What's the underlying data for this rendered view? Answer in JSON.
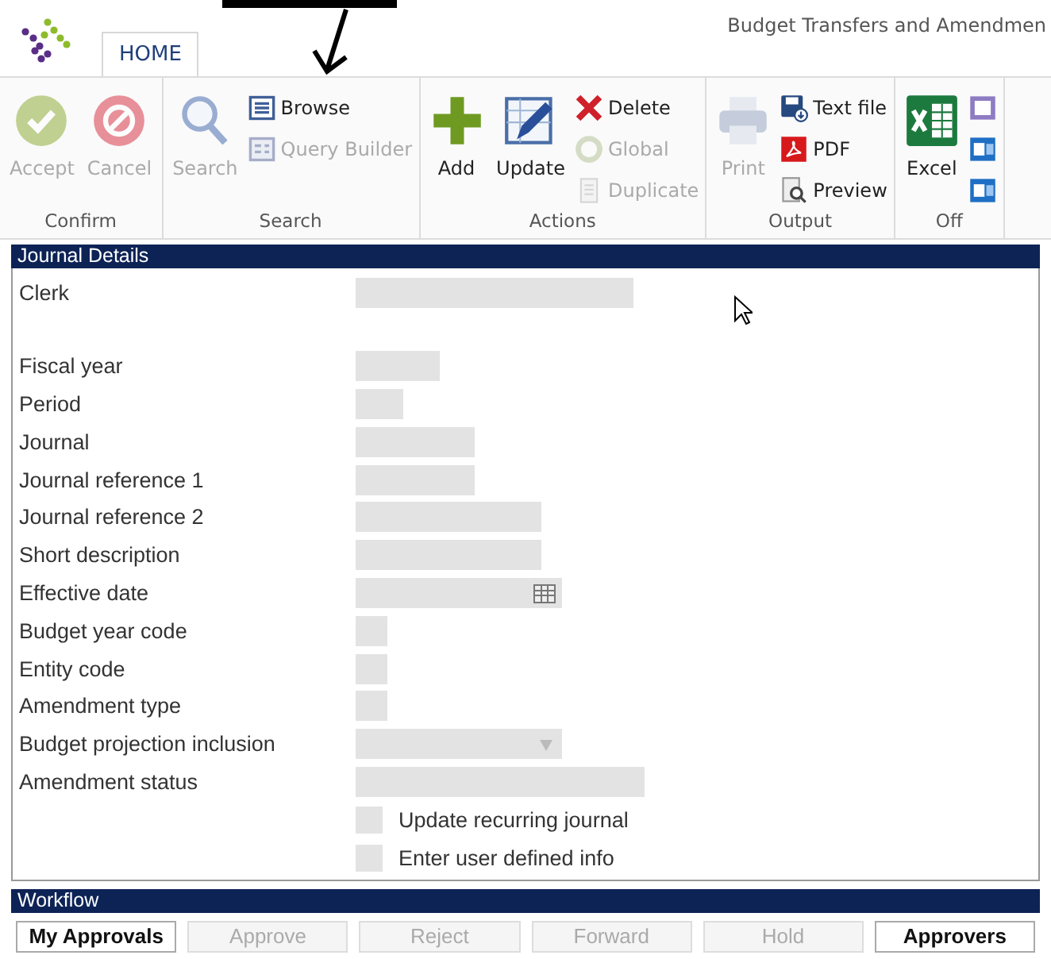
{
  "window": {
    "title": "Budget Transfers and Amendmen"
  },
  "tabs": [
    {
      "label": "HOME",
      "selected": true
    }
  ],
  "ribbon": [
    {
      "label": "Confirm",
      "items": [
        {
          "label": "Accept",
          "kind": "large",
          "disabled": true
        },
        {
          "label": "Cancel",
          "kind": "large",
          "disabled": true
        }
      ]
    },
    {
      "label": "Search",
      "items": [
        {
          "label": "Search",
          "kind": "large",
          "disabled": true
        },
        {
          "label": "Browse",
          "kind": "small",
          "disabled": false
        },
        {
          "label": "Query Builder",
          "kind": "small",
          "disabled": true
        }
      ]
    },
    {
      "label": "Actions",
      "items": [
        {
          "label": "Add",
          "kind": "large",
          "disabled": false
        },
        {
          "label": "Update",
          "kind": "large",
          "disabled": false
        },
        {
          "label": "Delete",
          "kind": "small",
          "disabled": false
        },
        {
          "label": "Global",
          "kind": "small",
          "disabled": true
        },
        {
          "label": "Duplicate",
          "kind": "small",
          "disabled": true
        }
      ]
    },
    {
      "label": "Output",
      "items": [
        {
          "label": "Print",
          "kind": "large",
          "disabled": true
        },
        {
          "label": "Text file",
          "kind": "small",
          "disabled": false
        },
        {
          "label": "PDF",
          "kind": "small",
          "disabled": false
        },
        {
          "label": "Preview",
          "kind": "small",
          "disabled": false
        }
      ]
    },
    {
      "label": "Off",
      "items": [
        {
          "label": "Excel",
          "kind": "large",
          "disabled": false
        },
        {
          "kind": "small",
          "disabled": false
        },
        {
          "kind": "small",
          "disabled": false
        },
        {
          "kind": "small",
          "disabled": false
        }
      ]
    }
  ],
  "journal_details": {
    "title": "Journal Details",
    "fields": [
      {
        "label": "Clerk",
        "kind": "text",
        "disabled": true
      },
      {
        "label": "Fiscal year",
        "kind": "text",
        "disabled": true
      },
      {
        "label": "Period",
        "kind": "text",
        "disabled": true
      },
      {
        "label": "Journal",
        "kind": "text",
        "disabled": true
      },
      {
        "label": "Journal reference 1",
        "kind": "text",
        "disabled": true
      },
      {
        "label": "Journal reference 2",
        "kind": "text",
        "disabled": true
      },
      {
        "label": "Short description",
        "kind": "text",
        "disabled": true
      },
      {
        "label": "Effective date",
        "kind": "date",
        "disabled": true
      },
      {
        "label": "Budget year code",
        "kind": "text",
        "disabled": true
      },
      {
        "label": "Entity code",
        "kind": "text",
        "disabled": true
      },
      {
        "label": "Amendment type",
        "kind": "text",
        "disabled": true
      },
      {
        "label": "Budget projection inclusion",
        "kind": "select",
        "disabled": true
      },
      {
        "label": "Amendment status",
        "kind": "text",
        "disabled": true
      }
    ],
    "options": [
      {
        "label": "Update recurring journal",
        "checked": false,
        "disabled": true
      },
      {
        "label": "Enter user defined info",
        "checked": false,
        "disabled": true
      }
    ]
  },
  "workflow": {
    "title": "Workflow",
    "buttons": [
      {
        "label": "My Approvals",
        "disabled": false
      },
      {
        "label": "Approve",
        "disabled": true
      },
      {
        "label": "Reject",
        "disabled": true
      },
      {
        "label": "Forward",
        "disabled": true
      },
      {
        "label": "Hold",
        "disabled": true
      },
      {
        "label": "Approvers",
        "disabled": false
      }
    ]
  }
}
